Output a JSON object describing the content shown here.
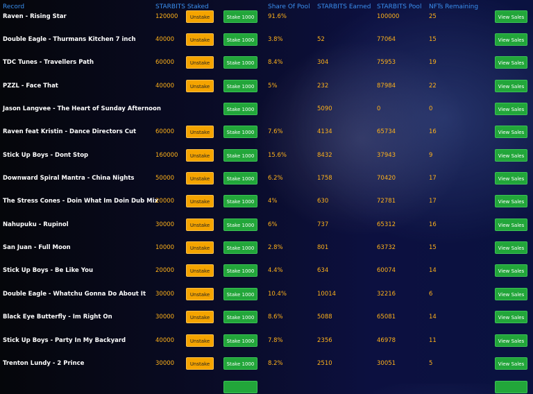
{
  "headers": {
    "record": "Record",
    "staked": "STARBITS Staked",
    "share": "Share Of Pool",
    "earned": "STARBITS Earned",
    "pool": "STARBITS Pool",
    "nfts": "NFTs Remaining"
  },
  "buttons": {
    "unstake": "Unstake",
    "stake": "Stake 1000",
    "view": "View Sales"
  },
  "rows": [
    {
      "record": "Raven - Rising Star",
      "staked": "120000",
      "share": "91.6%",
      "earned": "",
      "pool": "100000",
      "nfts": "25",
      "has_unstake": true
    },
    {
      "record": "Double Eagle - Thurmans Kitchen 7 inch",
      "staked": "40000",
      "share": "3.8%",
      "earned": "52",
      "pool": "77064",
      "nfts": "15",
      "has_unstake": true
    },
    {
      "record": "TDC Tunes - Travellers Path",
      "staked": "60000",
      "share": "8.4%",
      "earned": "304",
      "pool": "75953",
      "nfts": "19",
      "has_unstake": true
    },
    {
      "record": "PZZL - Face That",
      "staked": "40000",
      "share": "5%",
      "earned": "232",
      "pool": "87984",
      "nfts": "22",
      "has_unstake": true
    },
    {
      "record": "Jason Langvee - The Heart of Sunday Afternoon",
      "staked": "",
      "share": "",
      "earned": "5090",
      "pool": "0",
      "nfts": "0",
      "has_unstake": false
    },
    {
      "record": "Raven feat Kristin - Dance Directors Cut",
      "staked": "60000",
      "share": "7.6%",
      "earned": "4134",
      "pool": "65734",
      "nfts": "16",
      "has_unstake": true
    },
    {
      "record": "Stick Up Boys - Dont Stop",
      "staked": "160000",
      "share": "15.6%",
      "earned": "8432",
      "pool": "37943",
      "nfts": "9",
      "has_unstake": true
    },
    {
      "record": "Downward Spiral Mantra - China Nights",
      "staked": "50000",
      "share": "6.2%",
      "earned": "1758",
      "pool": "70420",
      "nfts": "17",
      "has_unstake": true
    },
    {
      "record": "The Stress Cones - Doin What Im Doin Dub Mix",
      "staked": "20000",
      "share": "4%",
      "earned": "630",
      "pool": "72781",
      "nfts": "17",
      "has_unstake": true
    },
    {
      "record": "Nahupuku - Rupinol",
      "staked": "30000",
      "share": "6%",
      "earned": "737",
      "pool": "65312",
      "nfts": "16",
      "has_unstake": true
    },
    {
      "record": "San Juan - Full Moon",
      "staked": "10000",
      "share": "2.8%",
      "earned": "801",
      "pool": "63732",
      "nfts": "15",
      "has_unstake": true
    },
    {
      "record": "Stick Up Boys - Be Like You",
      "staked": "20000",
      "share": "4.4%",
      "earned": "634",
      "pool": "60074",
      "nfts": "14",
      "has_unstake": true
    },
    {
      "record": "Double Eagle - Whatchu Gonna Do About It",
      "staked": "30000",
      "share": "10.4%",
      "earned": "10014",
      "pool": "32216",
      "nfts": "6",
      "has_unstake": true
    },
    {
      "record": "Black Eye Butterfly - Im Right On",
      "staked": "30000",
      "share": "8.6%",
      "earned": "5088",
      "pool": "65081",
      "nfts": "14",
      "has_unstake": true
    },
    {
      "record": "Stick Up Boys - Party In My Backyard",
      "staked": "40000",
      "share": "7.8%",
      "earned": "2356",
      "pool": "46978",
      "nfts": "11",
      "has_unstake": true
    },
    {
      "record": "Trenton Lundy - 2 Prince",
      "staked": "30000",
      "share": "8.2%",
      "earned": "2510",
      "pool": "30051",
      "nfts": "5",
      "has_unstake": true
    }
  ]
}
